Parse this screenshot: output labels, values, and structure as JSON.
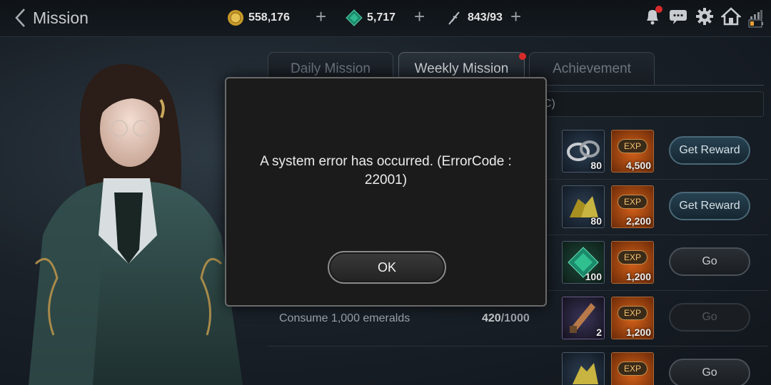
{
  "header": {
    "title": "Mission",
    "gold": "558,176",
    "emerald": "5,717",
    "stamina": "843/93"
  },
  "tabs": [
    {
      "label": "Daily Mission"
    },
    {
      "label": "Weekly Mission"
    },
    {
      "label": "Achievement"
    }
  ],
  "info_bar": {
    "text": "C)"
  },
  "missions": [
    {
      "name": "",
      "progress": "",
      "reward1_count": "80",
      "exp_label": "EXP",
      "exp_value": "4,500",
      "button": "Get Reward"
    },
    {
      "name": "",
      "progress": "",
      "reward1_count": "80",
      "exp_label": "EXP",
      "exp_value": "2,200",
      "button": "Get Reward"
    },
    {
      "name": "",
      "progress": "",
      "reward1_count": "100",
      "exp_label": "EXP",
      "exp_value": "1,200",
      "button": "Go"
    },
    {
      "name": "Consume 1,000 emeralds",
      "progress_current": "420",
      "progress_total": "/1000",
      "reward1_count": "2",
      "exp_label": "EXP",
      "exp_value": "1,200",
      "button": "Go"
    },
    {
      "name": "",
      "progress": "",
      "reward1_count": "",
      "exp_label": "EXP",
      "exp_value": "",
      "button": "Go"
    }
  ],
  "dialog": {
    "message": "A system error has occurred. (ErrorCode : 22001)",
    "ok_label": "OK"
  },
  "colors": {
    "accent_blue": "#274252",
    "exp_orange": "#d5621a",
    "notification_red": "#d92a2a"
  },
  "icons": [
    "back-chevron-icon",
    "gold-coin-icon",
    "emerald-gem-icon",
    "feather-quill-icon",
    "bell-icon",
    "chat-icon",
    "gear-icon",
    "home-icon",
    "signal-icon",
    "battery-icon"
  ]
}
